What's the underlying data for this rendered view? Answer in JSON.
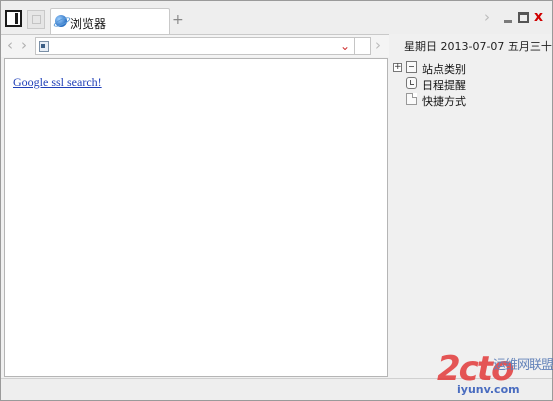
{
  "window": {
    "tab_title": "浏览器",
    "new_tab_glyph": "+",
    "forward_glyph": "›",
    "close_glyph": "x"
  },
  "toolbar": {
    "back_glyph": "‹",
    "forward_glyph": "›",
    "address_value": "",
    "address_placeholder": "",
    "dropdown_glyph": "⌄",
    "go_glyph": "›"
  },
  "header": {
    "date_text": "星期日 2013-07-07 五月三十"
  },
  "content": {
    "link_text": "Google ssl search!"
  },
  "sidebar": {
    "items": [
      {
        "label": "站点类别",
        "expander": "+",
        "icon": "category-icon"
      },
      {
        "label": "日程提醒",
        "icon": "clock-icon"
      },
      {
        "label": "快捷方式",
        "icon": "shortcut-icon"
      }
    ]
  },
  "watermark": {
    "logo": "2cto",
    "name": "运维网联盟",
    "url": "iyunv.com"
  },
  "colors": {
    "close": "#d00000",
    "link": "#1f3fb8",
    "dropdown": "#d03030"
  }
}
